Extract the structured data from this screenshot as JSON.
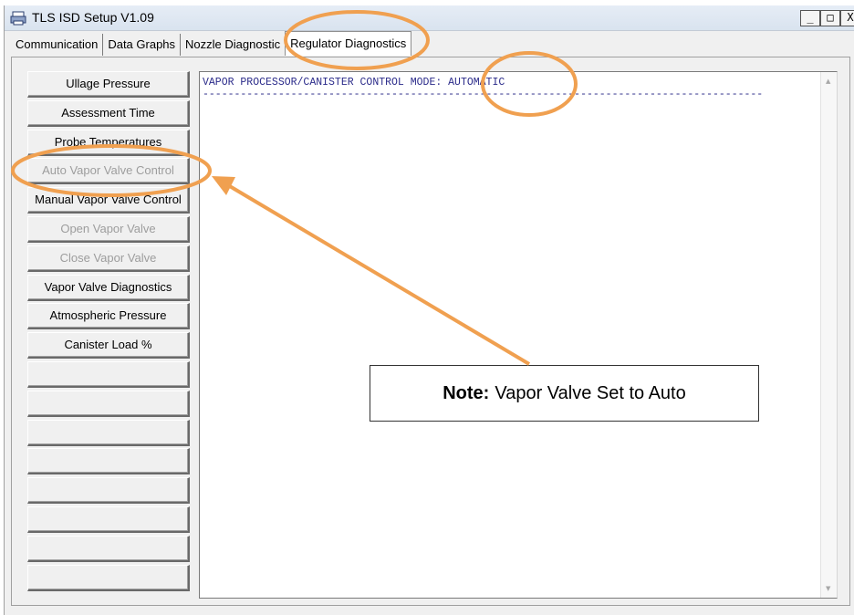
{
  "window": {
    "title": "TLS ISD Setup V1.09",
    "controls": [
      "_",
      "□",
      "X"
    ]
  },
  "tabs": [
    {
      "label": "Communication",
      "active": false
    },
    {
      "label": "Data Graphs",
      "active": false
    },
    {
      "label": "Nozzle Diagnostic",
      "active": false
    },
    {
      "label": "Regulator Diagnostics",
      "active": true
    }
  ],
  "side_buttons": [
    {
      "label": "Ullage Pressure",
      "enabled": true
    },
    {
      "label": "Assessment Time",
      "enabled": true
    },
    {
      "label": "Probe Temperatures",
      "enabled": true
    },
    {
      "label": "Auto Vapor Valve Control",
      "enabled": false
    },
    {
      "label": "Manual Vapor Valve Control",
      "enabled": true
    },
    {
      "label": "Open Vapor Valve",
      "enabled": false
    },
    {
      "label": "Close Vapor Valve",
      "enabled": false
    },
    {
      "label": "Vapor Valve Diagnostics",
      "enabled": true
    },
    {
      "label": "Atmospheric Pressure",
      "enabled": true
    },
    {
      "label": "Canister Load %",
      "enabled": true
    },
    {
      "label": "",
      "enabled": true
    },
    {
      "label": "",
      "enabled": true
    },
    {
      "label": "",
      "enabled": true
    },
    {
      "label": "",
      "enabled": true
    },
    {
      "label": "",
      "enabled": true
    },
    {
      "label": "",
      "enabled": true
    },
    {
      "label": "",
      "enabled": true
    },
    {
      "label": "",
      "enabled": true
    }
  ],
  "output": {
    "line1": "VAPOR PROCESSOR/CANISTER CONTROL MODE: AUTOMATIC",
    "line2": "-----------------------------------------------------------------------------------------"
  },
  "annotation": {
    "note_bold": "Note:",
    "note_text": "Vapor Valve Set to Auto",
    "color": "#f0a050"
  }
}
